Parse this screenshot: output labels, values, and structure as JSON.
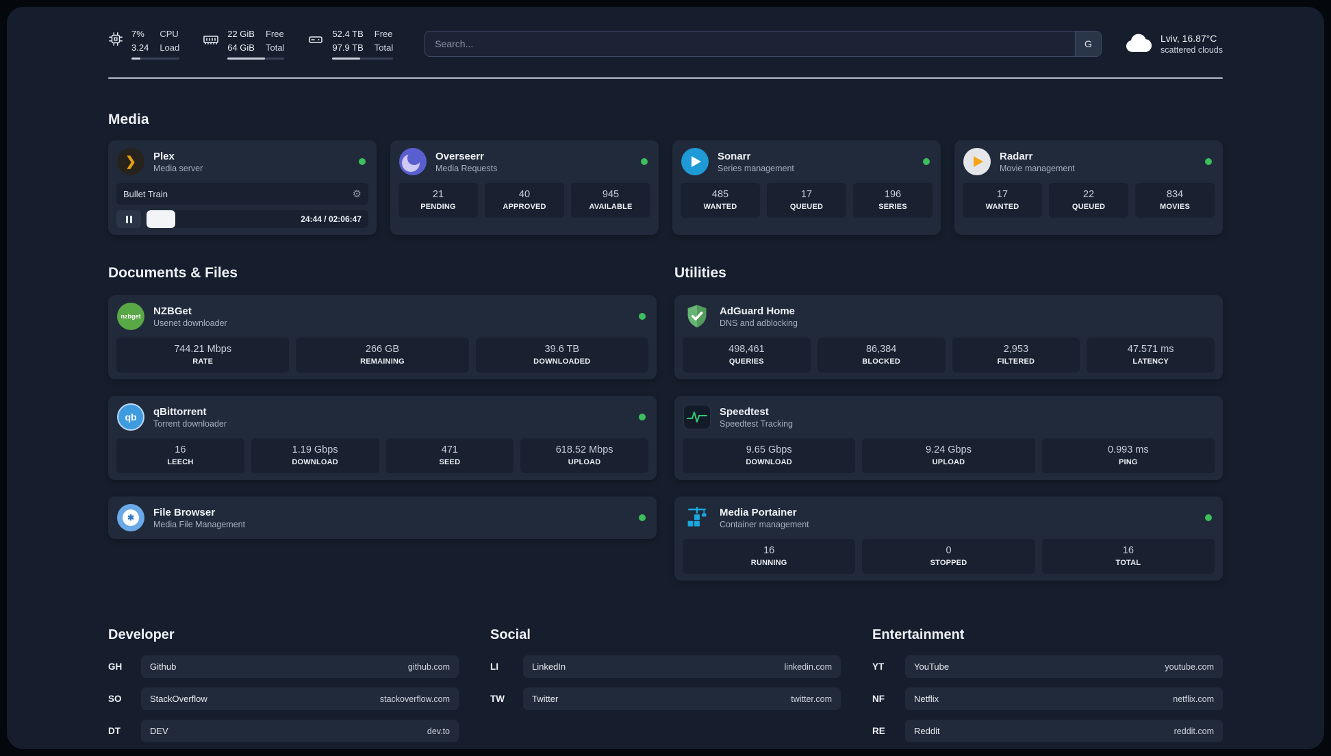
{
  "colors": {
    "status_online": "#3cbf5d",
    "surface": "#161e2d",
    "card": "#212a3a"
  },
  "topbar": {
    "cpu": {
      "icon": "cpu-icon",
      "line1": "7%",
      "line2": "3.24",
      "label1": "CPU",
      "label2": "Load",
      "bar_percent": 18
    },
    "memory": {
      "icon": "ram-icon",
      "line1": "22 GiB",
      "line2": "64 GiB",
      "label1": "Free",
      "label2": "Total",
      "bar_percent": 66
    },
    "disk": {
      "icon": "disk-icon",
      "line1": "52.4 TB",
      "line2": "97.9 TB",
      "label1": "Free",
      "label2": "Total",
      "bar_percent": 46
    },
    "search": {
      "icon": "search-engine-icon",
      "placeholder": "Search...",
      "button_label": "G"
    },
    "weather": {
      "icon": "cloud-icon",
      "location": "Lviv, 16.87°C",
      "condition": "scattered clouds"
    }
  },
  "sections": {
    "media": {
      "title": "Media",
      "apps": [
        {
          "name": "Plex",
          "subtitle": "Media server",
          "icon": "plex-icon",
          "online": true,
          "player": {
            "track": "Bullet Train",
            "time": "24:44 / 02:06:47",
            "progress_percent": 13,
            "settings_icon": "gear-icon",
            "pause_icon": "pause-icon"
          }
        },
        {
          "name": "Overseerr",
          "subtitle": "Media Requests",
          "icon": "overseerr-icon",
          "online": true,
          "stats": [
            {
              "value": "21",
              "label": "PENDING"
            },
            {
              "value": "40",
              "label": "APPROVED"
            },
            {
              "value": "945",
              "label": "AVAILABLE"
            }
          ]
        },
        {
          "name": "Sonarr",
          "subtitle": "Series management",
          "icon": "sonarr-icon",
          "online": true,
          "stats": [
            {
              "value": "485",
              "label": "WANTED"
            },
            {
              "value": "17",
              "label": "QUEUED"
            },
            {
              "value": "196",
              "label": "SERIES"
            }
          ]
        },
        {
          "name": "Radarr",
          "subtitle": "Movie management",
          "icon": "radarr-icon",
          "online": true,
          "stats": [
            {
              "value": "17",
              "label": "WANTED"
            },
            {
              "value": "22",
              "label": "QUEUED"
            },
            {
              "value": "834",
              "label": "MOVIES"
            }
          ]
        }
      ]
    },
    "documents": {
      "title": "Documents & Files",
      "apps": [
        {
          "name": "NZBGet",
          "subtitle": "Usenet downloader",
          "icon": "nzbget-icon",
          "online": true,
          "stats": [
            {
              "value": "744.21 Mbps",
              "label": "RATE"
            },
            {
              "value": "266 GB",
              "label": "REMAINING"
            },
            {
              "value": "39.6 TB",
              "label": "DOWNLOADED"
            }
          ]
        },
        {
          "name": "qBittorrent",
          "subtitle": "Torrent downloader",
          "icon": "qbittorrent-icon",
          "online": true,
          "stats": [
            {
              "value": "16",
              "label": "LEECH"
            },
            {
              "value": "1.19 Gbps",
              "label": "DOWNLOAD"
            },
            {
              "value": "471",
              "label": "SEED"
            },
            {
              "value": "618.52 Mbps",
              "label": "UPLOAD"
            }
          ]
        },
        {
          "name": "File Browser",
          "subtitle": "Media File Management",
          "icon": "filebrowser-icon",
          "online": true
        }
      ]
    },
    "utilities": {
      "title": "Utilities",
      "apps": [
        {
          "name": "AdGuard Home",
          "subtitle": "DNS and adblocking",
          "icon": "adguard-icon",
          "stats": [
            {
              "value": "498,461",
              "label": "QUERIES"
            },
            {
              "value": "86,384",
              "label": "BLOCKED"
            },
            {
              "value": "2,953",
              "label": "FILTERED"
            },
            {
              "value": "47.571 ms",
              "label": "LATENCY"
            }
          ]
        },
        {
          "name": "Speedtest",
          "subtitle": "Speedtest Tracking",
          "icon": "speedtest-icon",
          "stats": [
            {
              "value": "9.65 Gbps",
              "label": "DOWNLOAD"
            },
            {
              "value": "9.24 Gbps",
              "label": "UPLOAD"
            },
            {
              "value": "0.993 ms",
              "label": "PING"
            }
          ]
        },
        {
          "name": "Media Portainer",
          "subtitle": "Container management",
          "icon": "portainer-icon",
          "online": true,
          "stats": [
            {
              "value": "16",
              "label": "RUNNING"
            },
            {
              "value": "0",
              "label": "STOPPED"
            },
            {
              "value": "16",
              "label": "TOTAL"
            }
          ]
        }
      ]
    }
  },
  "bookmarks": {
    "groups": [
      {
        "title": "Developer",
        "items": [
          {
            "abbr": "GH",
            "name": "Github",
            "url": "github.com"
          },
          {
            "abbr": "SO",
            "name": "StackOverflow",
            "url": "stackoverflow.com"
          },
          {
            "abbr": "DT",
            "name": "DEV",
            "url": "dev.to"
          }
        ]
      },
      {
        "title": "Social",
        "items": [
          {
            "abbr": "LI",
            "name": "LinkedIn",
            "url": "linkedin.com"
          },
          {
            "abbr": "TW",
            "name": "Twitter",
            "url": "twitter.com"
          }
        ]
      },
      {
        "title": "Entertainment",
        "items": [
          {
            "abbr": "YT",
            "name": "YouTube",
            "url": "youtube.com"
          },
          {
            "abbr": "NF",
            "name": "Netflix",
            "url": "netflix.com"
          },
          {
            "abbr": "RE",
            "name": "Reddit",
            "url": "reddit.com"
          }
        ]
      }
    ]
  }
}
